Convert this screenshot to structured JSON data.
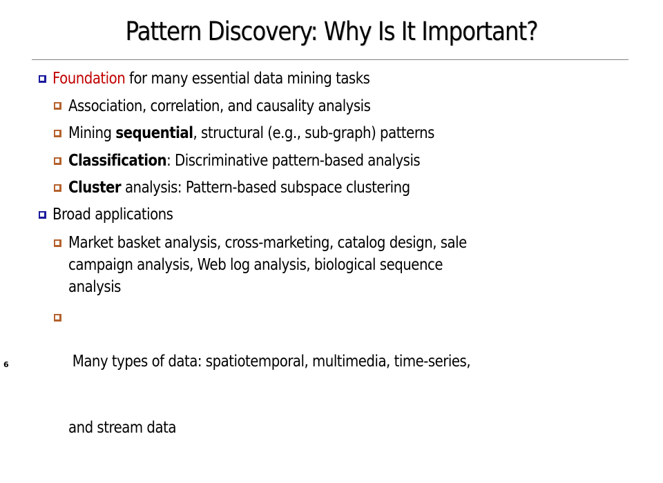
{
  "slide": {
    "title": "Pattern Discovery: Why Is It Important?",
    "number": "6",
    "colors": {
      "accent_red": "#c00000",
      "bullet_level1": "#1a1a9c",
      "bullet_level2": "#b4612c",
      "rule": "#808080"
    },
    "bullets": [
      {
        "level": 1,
        "icon": "square-bullet-icon",
        "accent": "Foundation",
        "text": " for many essential data mining tasks",
        "children": [
          {
            "level": 2,
            "icon": "square-bullet-icon",
            "text": "Association, correlation, and causality analysis"
          },
          {
            "level": 2,
            "icon": "square-bullet-icon",
            "pre": "Mining ",
            "bold": "sequential",
            "text": ", structural (e.g., sub-graph) patterns"
          },
          {
            "level": 2,
            "icon": "square-bullet-icon",
            "bold": "Classification",
            "text": ": Discriminative pattern-based analysis"
          },
          {
            "level": 2,
            "icon": "square-bullet-icon",
            "bold": "Cluster",
            "text": " analysis: Pattern-based subspace clustering"
          }
        ]
      },
      {
        "level": 1,
        "icon": "square-bullet-icon",
        "text": "Broad applications",
        "children": [
          {
            "level": 2,
            "icon": "square-bullet-icon",
            "lines": [
              "Market basket analysis, cross-marketing, catalog design, sale",
              "campaign analysis, Web log analysis, biological sequence",
              "analysis"
            ]
          },
          {
            "level": 2,
            "icon": "square-bullet-icon",
            "lines": [
              " Many types of data: spatiotemporal, multimedia, time-series,",
              "and stream data"
            ]
          }
        ]
      }
    ]
  }
}
